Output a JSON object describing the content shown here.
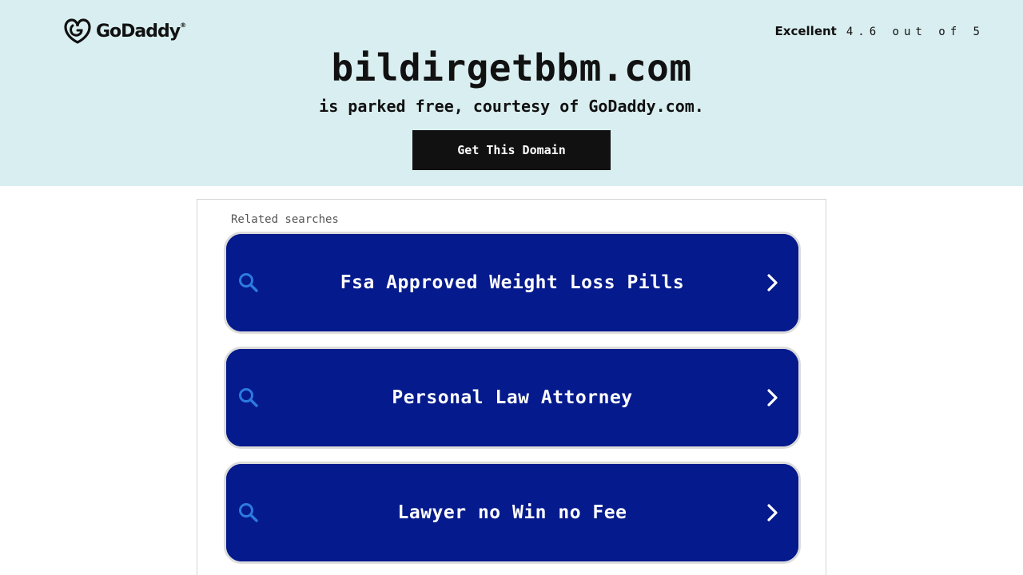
{
  "brand": {
    "logo_text": "GoDaddy",
    "trademark": "®"
  },
  "rating": {
    "label": "Excellent",
    "score": "4.6 out of 5"
  },
  "domain": {
    "name": "bildirgetbbm.com",
    "subtitle": "is parked free, courtesy of GoDaddy.com."
  },
  "cta": {
    "label": "Get This Domain"
  },
  "related": {
    "heading": "Related searches",
    "items": [
      {
        "label": "Fsa Approved Weight Loss Pills"
      },
      {
        "label": "Personal Law Attorney"
      },
      {
        "label": "Lawyer no Win no Fee"
      }
    ]
  },
  "colors": {
    "hero_bg": "#d9eef0",
    "item_bg": "#051a8c",
    "icon_blue": "#2d7be0",
    "cta_bg": "#111111"
  },
  "icons": [
    "godaddy-logo-icon",
    "search-icon",
    "chevron-right-icon"
  ]
}
